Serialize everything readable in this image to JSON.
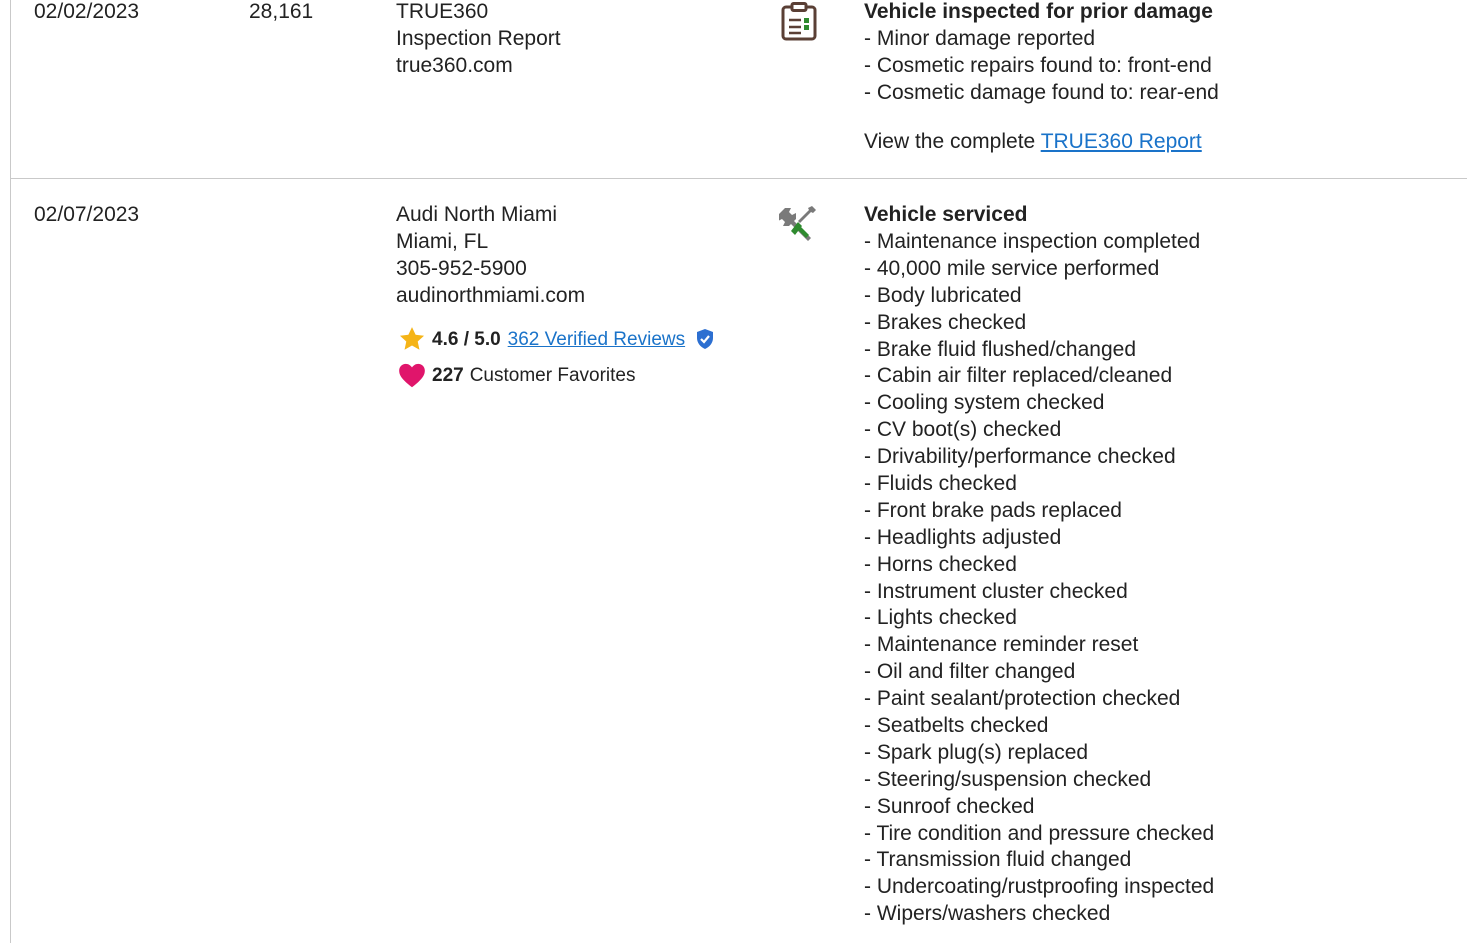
{
  "records": [
    {
      "date": "02/02/2023",
      "odometer": "28,161",
      "source": {
        "lines": [
          "TRUE360",
          "Inspection Report",
          "true360.com"
        ]
      },
      "icon": "clipboard-icon",
      "comments": {
        "heading": "Vehicle inspected for prior damage",
        "items": [
          "Minor damage reported",
          "Cosmetic repairs found to: front-end",
          "Cosmetic damage found to: rear-end"
        ],
        "report_prefix": "View the complete",
        "report_link": "TRUE360 Report"
      }
    },
    {
      "date": "02/07/2023",
      "odometer": "",
      "source": {
        "lines": [
          "Audi North Miami",
          "Miami, FL",
          "305-952-5900",
          "audinorthmiami.com"
        ],
        "rating": "4.6 / 5.0",
        "reviews_link": "362 Verified Reviews",
        "favorites_count": "227",
        "favorites_label": "Customer Favorites"
      },
      "icon": "service-tools-icon",
      "comments": {
        "heading": "Vehicle serviced",
        "items": [
          "Maintenance inspection completed",
          "40,000 mile service performed",
          "Body lubricated",
          "Brakes checked",
          "Brake fluid flushed/changed",
          "Cabin air filter replaced/cleaned",
          "Cooling system checked",
          "CV boot(s) checked",
          "Drivability/performance checked",
          "Fluids checked",
          "Front brake pads replaced",
          "Headlights adjusted",
          "Horns checked",
          "Instrument cluster checked",
          "Lights checked",
          "Maintenance reminder reset",
          "Oil and filter changed",
          "Paint sealant/protection checked",
          "Seatbelts checked",
          "Spark plug(s) replaced",
          "Steering/suspension checked",
          "Sunroof checked",
          "Tire condition and pressure checked",
          "Transmission fluid changed",
          "Undercoating/rustproofing inspected",
          "Wipers/washers checked"
        ]
      }
    }
  ],
  "colors": {
    "link": "#1a73c9",
    "star": "#f5b417",
    "heart": "#e0156b",
    "verified": "#2c6fd1",
    "tool_green": "#2e8a2e",
    "clipboard": "#5a3f35"
  }
}
